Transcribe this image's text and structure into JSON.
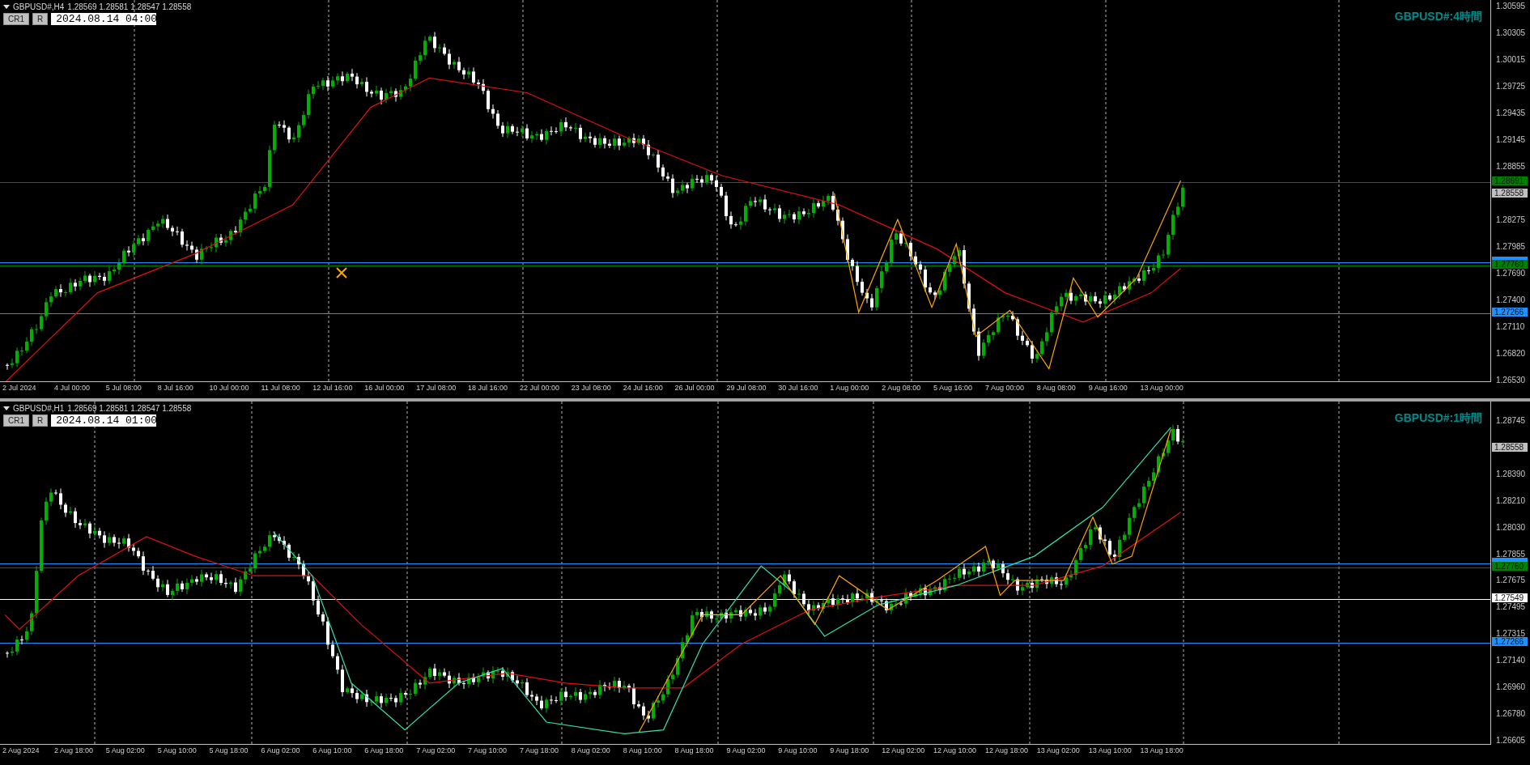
{
  "panels": [
    {
      "title": "GBPUSD#,H4",
      "ohlc": "1.28569 1.28581 1.28547 1.28558",
      "buttons": [
        "CR1",
        "R"
      ],
      "time_field": "2024.08.14 04:00",
      "chart_label": "GBPUSD#:4時間",
      "horizontal_lines": [
        {
          "color": "#008000"
        },
        {
          "color": "#1e90ff"
        },
        {
          "color": "#008000"
        },
        {
          "color": "#1e90ff"
        }
      ],
      "price_ticks": [
        "1.30595",
        "1.30305",
        "1.30015",
        "1.29725",
        "1.29435",
        "1.29145",
        "1.28855",
        "1.28275",
        "1.27985",
        "1.27690",
        "1.27400",
        "1.27110",
        "1.26820",
        "1.26530"
      ],
      "price_tags": [
        {
          "text": "1.28691",
          "color": "#008000"
        },
        {
          "text": "1.28558",
          "color": "#c0c0c0"
        },
        {
          "color": "#1e90ff"
        },
        {
          "text": "1.27760",
          "color": "#008000"
        },
        {
          "text": "1.27266",
          "color": "#1e90ff"
        }
      ],
      "time_labels": [
        "2 Jul 2024",
        "4 Jul 00:00",
        "5 Jul 08:00",
        "8 Jul 16:00",
        "10 Jul 00:00",
        "11 Jul 08:00",
        "12 Jul 16:00",
        "16 Jul 00:00",
        "17 Jul 08:00",
        "18 Jul 16:00",
        "22 Jul 00:00",
        "23 Jul 08:00",
        "24 Jul 16:00",
        "26 Jul 00:00",
        "29 Jul 08:00",
        "30 Jul 16:00",
        "1 Aug 00:00",
        "2 Aug 08:00",
        "5 Aug 16:00",
        "7 Aug 00:00",
        "8 Aug 08:00",
        "9 Aug 16:00",
        "13 Aug 00:00"
      ]
    },
    {
      "title": "GBPUSD#,H1",
      "ohlc": "1.28569 1.28581 1.28547 1.28558",
      "buttons": [
        "CR1",
        "R"
      ],
      "time_field": "2024.08.14 01:00",
      "chart_label": "GBPUSD#:1時間",
      "horizontal_lines": [
        {
          "color": "#1e90ff"
        },
        {
          "color": "#008000"
        },
        {
          "color": "#ffffff"
        },
        {
          "color": "#1e90ff"
        }
      ],
      "price_ticks": [
        "1.28745",
        "1.28390",
        "1.28210",
        "1.28030",
        "1.27855",
        "1.27675",
        "1.27495",
        "1.27315",
        "1.27140",
        "1.26960",
        "1.26780",
        "1.26605"
      ],
      "price_tags": [
        {
          "text": "1.28558",
          "color": "#c0c0c0"
        },
        {
          "color": "#1e90ff"
        },
        {
          "text": "1.27760",
          "color": "#008000"
        },
        {
          "text": "1.27549",
          "color": "#ffffff"
        },
        {
          "text": "1.27266",
          "color": "#1e90ff"
        }
      ],
      "time_labels": [
        "2 Aug 2024",
        "2 Aug 18:00",
        "5 Aug 02:00",
        "5 Aug 10:00",
        "5 Aug 18:00",
        "6 Aug 02:00",
        "6 Aug 10:00",
        "6 Aug 18:00",
        "7 Aug 02:00",
        "7 Aug 10:00",
        "7 Aug 18:00",
        "8 Aug 02:00",
        "8 Aug 10:00",
        "8 Aug 18:00",
        "9 Aug 02:00",
        "9 Aug 10:00",
        "9 Aug 18:00",
        "12 Aug 02:00",
        "12 Aug 10:00",
        "12 Aug 18:00",
        "13 Aug 02:00",
        "13 Aug 10:00",
        "13 Aug 18:00"
      ]
    }
  ]
}
